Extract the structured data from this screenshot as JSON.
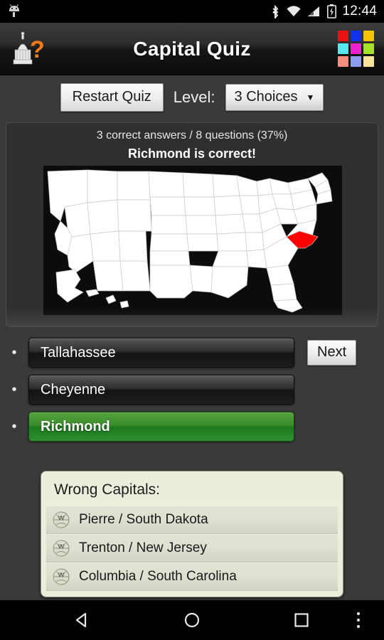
{
  "statusbar": {
    "time": "12:44",
    "icons": [
      "android-robot-icon",
      "bluetooth-icon",
      "wifi-icon",
      "cell-signal-icon",
      "battery-charging-icon"
    ]
  },
  "titlebar": {
    "title": "Capital Quiz",
    "app_icon": "capitol-question-icon",
    "grid_icon": "color-grid-icon",
    "grid_colors": [
      "#ee1111",
      "#1133ee",
      "#f5c400",
      "#55e8ee",
      "#ee22cc",
      "#a6e226",
      "#f58d7d",
      "#8e9cf0",
      "#f7e39a"
    ]
  },
  "controls": {
    "restart_label": "Restart Quiz",
    "level_label": "Level:",
    "level_value": "3 Choices",
    "level_caret": "▼",
    "level_options": [
      "3 Choices"
    ]
  },
  "quiz": {
    "score_text": "3 correct answers / 8 questions (37%)",
    "verdict_text": "Richmond is correct!",
    "correct_count": 3,
    "question_count": 8,
    "percent": "37%",
    "map_name": "usa-map",
    "highlight_state": "Virginia",
    "highlight_color": "#ff0000",
    "state_fill": "#ffffff",
    "map_background": "#0c0c0c"
  },
  "answers": {
    "bullet": "•",
    "options": [
      {
        "label": "Tallahassee",
        "state": "normal"
      },
      {
        "label": "Cheyenne",
        "state": "normal"
      },
      {
        "label": "Richmond",
        "state": "correct"
      }
    ],
    "next_label": "Next"
  },
  "wrong_capitals": {
    "title": "Wrong Capitals:",
    "items": [
      {
        "label": "Pierre / South Dakota",
        "icon": "wikipedia-globe-icon"
      },
      {
        "label": "Trenton / New Jersey",
        "icon": "wikipedia-globe-icon"
      },
      {
        "label": "Columbia / South Carolina",
        "icon": "wikipedia-globe-icon"
      }
    ]
  },
  "navbar": {
    "back": "back-icon",
    "home": "home-icon",
    "recents": "recents-icon",
    "more": "overflow-menu-icon"
  }
}
